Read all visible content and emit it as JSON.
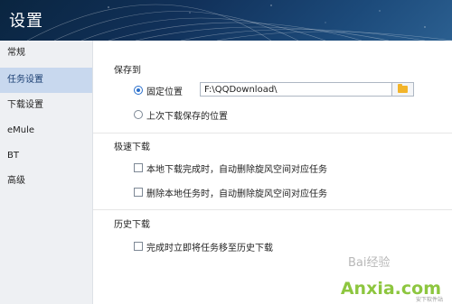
{
  "window": {
    "title": "设置"
  },
  "sidebar": {
    "items": [
      {
        "label": "常规"
      },
      {
        "label": "任务设置",
        "active": true
      },
      {
        "label": "下载设置"
      },
      {
        "label": "eMule"
      },
      {
        "label": "BT"
      },
      {
        "label": "高级"
      }
    ]
  },
  "save_to": {
    "heading": "保存到",
    "fixed_location_label": "固定位置",
    "fixed_location_selected": true,
    "path_value": "F:\\QQDownload\\",
    "last_location_label": "上次下载保存的位置",
    "folder_icon": "folder-icon"
  },
  "speed_download": {
    "heading": "极速下载",
    "option1_label": "本地下载完成时，自动删除旋风空间对应任务",
    "option1_checked": false,
    "option2_label": "删除本地任务时，自动删除旋风空间对应任务",
    "option2_checked": false
  },
  "history_download": {
    "heading": "历史下载",
    "option1_label": "完成时立即将任务移至历史下载",
    "option1_checked": false
  },
  "watermark": {
    "brand": "Anxia.com",
    "sub": "安下软件站",
    "baidu": "Bai经验"
  },
  "colors": {
    "header_bg": "#11315a",
    "sidebar_bg": "#eef0f3",
    "sidebar_active": "#c8d8ee",
    "accent": "#2a6fcb",
    "folder": "#f2b42b"
  }
}
